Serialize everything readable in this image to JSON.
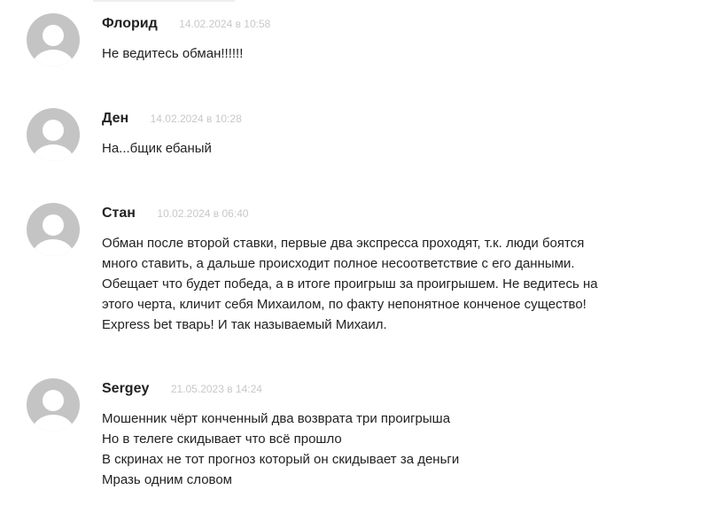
{
  "comments": [
    {
      "author": "Флорид",
      "date": "14.02.2024 в 10:58",
      "lines": [
        "Не ведитесь обман!!!!!!"
      ]
    },
    {
      "author": "Ден",
      "date": "14.02.2024 в 10:28",
      "lines": [
        "На...бщик ебаный"
      ]
    },
    {
      "author": "Стан",
      "date": "10.02.2024 в 06:40",
      "lines": [
        "Обман после второй ставки, первые два экспресса проходят, т.к. люди боятся",
        "много ставить, а дальше происходит полное несоответствие с его данными.",
        "Обещает что будет победа, а в итоге проигрыш за проигрышем. Не ведитесь на",
        "этого черта, кличит себя Михаилом, по факту непонятное конченое существо!",
        "Express bet тварь! И так называемый Михаил."
      ]
    },
    {
      "author": "Sergey",
      "date": "21.05.2023 в 14:24",
      "lines": [
        "Мошенник чёрт конченный два возврата три проигрыша",
        "Но в телеге скидывает что всё прошло",
        "В скринах не тот прогноз который он скидывает за деньги",
        "Мразь одним словом"
      ]
    }
  ]
}
